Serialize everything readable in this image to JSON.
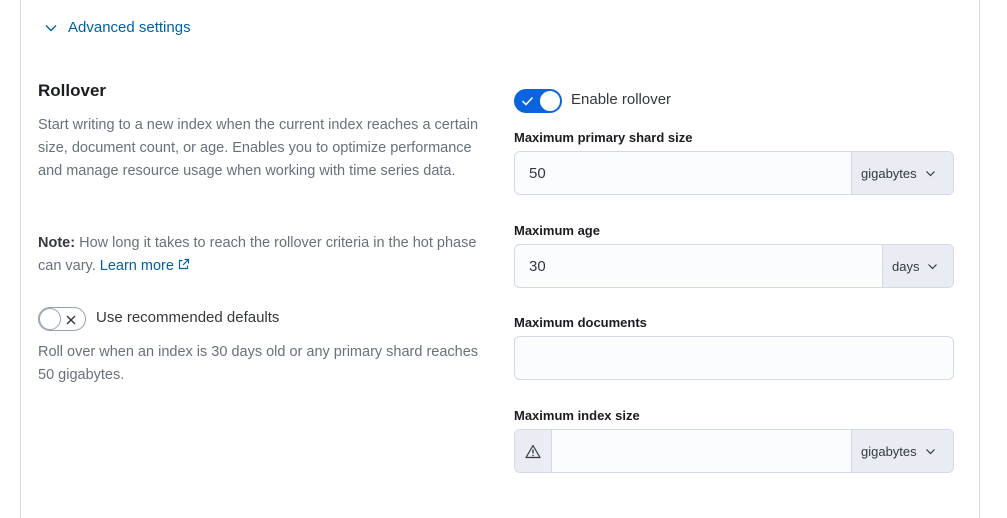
{
  "advanced": {
    "toggle_label": "Advanced settings"
  },
  "rollover": {
    "title": "Rollover",
    "description": "Start writing to a new index when the current index reaches a certain size, document count, or age. Enables you to optimize performance and manage resource usage when working with time series data.",
    "note_prefix": "Note:",
    "note_text": " How long it takes to reach the rollover criteria in the hot phase can vary. ",
    "learn_more": "Learn more",
    "recommended": {
      "label": "Use recommended defaults",
      "enabled": false,
      "description": "Roll over when an index is 30 days old or any primary shard reaches 50 gigabytes."
    },
    "enable": {
      "label": "Enable rollover",
      "enabled": true
    }
  },
  "fields": {
    "primary_shard_size": {
      "label": "Maximum primary shard size",
      "value": "50",
      "unit": "gigabytes"
    },
    "max_age": {
      "label": "Maximum age",
      "value": "30",
      "unit": "days"
    },
    "max_docs": {
      "label": "Maximum documents",
      "value": ""
    },
    "max_index_size": {
      "label": "Maximum index size",
      "value": "",
      "unit": "gigabytes"
    }
  },
  "icons": {
    "advanced_toggle": "chevron-down-icon",
    "external_link": "external-link-icon",
    "check": "check-icon",
    "cross": "cross-icon",
    "warning": "warning-icon"
  },
  "colors": {
    "link": "#0061a6",
    "switch_on": "#0b64dd"
  }
}
